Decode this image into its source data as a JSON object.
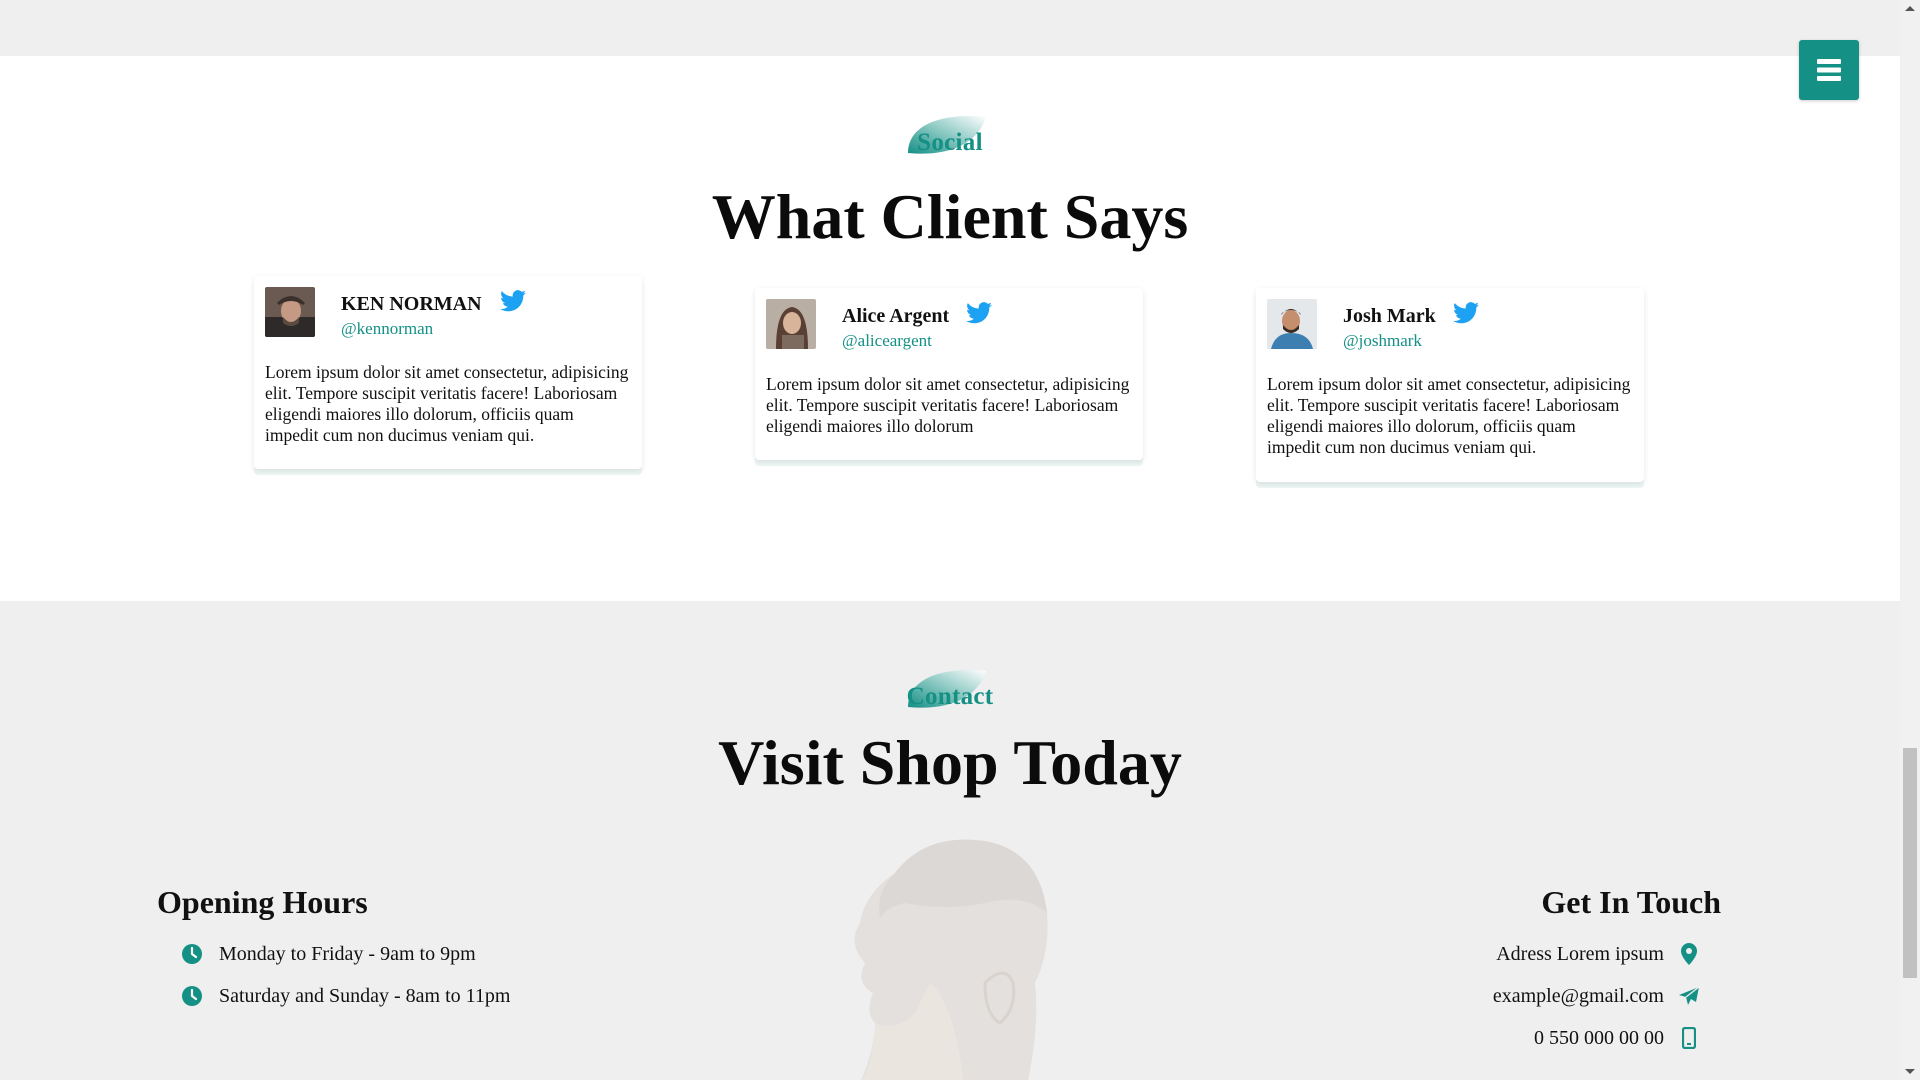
{
  "social": {
    "tag": "Social",
    "title": "What Client Says",
    "testimonials": [
      {
        "name": "KEN NORMAN",
        "handle": "@kennorman",
        "text": "Lorem ipsum dolor sit amet consectetur, adipisicing elit. Tempore suscipit veritatis facere! Laboriosam eligendi maiores illo dolorum, officiis quam impedit cum non ducimus veniam qui."
      },
      {
        "name": "Alice Argent",
        "handle": "@aliceargent",
        "text": "Lorem ipsum dolor sit amet consectetur, adipisicing elit. Tempore suscipit veritatis facere! Laboriosam eligendi maiores illo dolorum"
      },
      {
        "name": "Josh Mark",
        "handle": "@joshmark",
        "text": "Lorem ipsum dolor sit amet consectetur, adipisicing elit. Tempore suscipit veritatis facere! Laboriosam eligendi maiores illo dolorum, officiis quam impedit cum non ducimus veniam qui."
      }
    ]
  },
  "contact": {
    "tag": "Contact",
    "title": "Visit Shop Today",
    "opening_hours": {
      "title": "Opening Hours",
      "items": [
        "Monday to Friday - 9am to 9pm",
        "Saturday and Sunday - 8am to 11pm"
      ]
    },
    "get_in_touch": {
      "title": "Get In Touch",
      "address": "Adress Lorem ipsum",
      "email": "example@gmail.com",
      "phone": "0 550 000 00 00"
    }
  },
  "icons": {
    "menu": "hamburger-menu-icon",
    "twitter": "twitter-icon",
    "clock": "clock-icon",
    "location": "location-pin-icon",
    "send": "paper-plane-icon",
    "phone": "mobile-phone-icon"
  },
  "colors": {
    "accent": "#149085",
    "twitter": "#1da1f2",
    "page_background": "#efefef",
    "section_background": "#ffffff"
  }
}
